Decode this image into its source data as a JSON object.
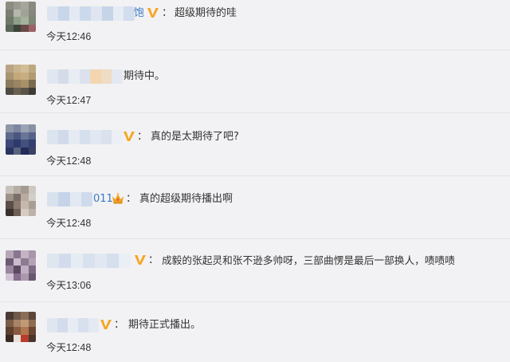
{
  "comments": [
    {
      "name_suffix": "饱",
      "separator": "：",
      "text": "超级期待的哇",
      "time": "今天12:46",
      "badge": "v-badge-icon"
    },
    {
      "name_suffix": "",
      "separator": "",
      "text": "期待中。",
      "time": "今天12:47",
      "badge": ""
    },
    {
      "name_suffix": "",
      "separator": "：",
      "text": "真的是太期待了吧?",
      "time": "今天12:48",
      "badge": "v-badge-icon"
    },
    {
      "name_suffix": "011",
      "separator": "：",
      "text": "真的超级期待播出啊",
      "time": "今天12:48",
      "badge": "crown-icon"
    },
    {
      "name_suffix": "",
      "separator": "：",
      "text": "成毅的张起灵和张不逊多帅呀，三部曲愣是最后一部换人，啧啧啧",
      "time": "今天13:06",
      "badge": "v-badge-icon"
    },
    {
      "name_suffix": "",
      "separator": "：",
      "text": "期待正式播出。",
      "time": "今天12:48",
      "badge": "v-badge-icon"
    }
  ],
  "colors": {
    "background": "#f2f2f4",
    "text": "#333333",
    "link": "#3b79c4",
    "v_badge": "#f5a623",
    "crown": "#f0a020"
  }
}
